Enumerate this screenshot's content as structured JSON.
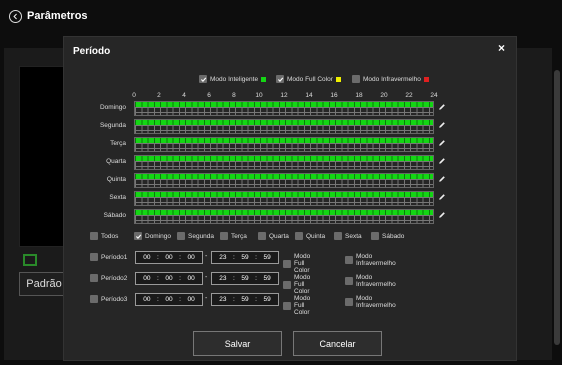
{
  "page": {
    "title": "Parâmetros"
  },
  "background": {
    "default_button": "Padrão"
  },
  "dialog": {
    "title": "Período",
    "close_label": "×",
    "legend": [
      {
        "label": "Modo Inteligente",
        "checked": true,
        "color": "#14d614"
      },
      {
        "label": "Modo Full Color",
        "checked": true,
        "color": "#f0f000"
      },
      {
        "label": "Modo Infravermelho",
        "checked": false,
        "color": "#e02020"
      }
    ],
    "hours": [
      "0",
      "2",
      "4",
      "6",
      "8",
      "10",
      "12",
      "14",
      "16",
      "18",
      "20",
      "22",
      "24"
    ],
    "days": [
      {
        "label": "Domingo",
        "coverage": 1.0
      },
      {
        "label": "Segunda",
        "coverage": 1.0
      },
      {
        "label": "Terça",
        "coverage": 1.0
      },
      {
        "label": "Quarta",
        "coverage": 1.0
      },
      {
        "label": "Quinta",
        "coverage": 1.0
      },
      {
        "label": "Sexta",
        "coverage": 1.0
      },
      {
        "label": "Sábado",
        "coverage": 1.0
      }
    ],
    "day_select": [
      {
        "label": "Todos",
        "checked": false
      },
      {
        "label": "Domingo",
        "checked": true
      },
      {
        "label": "Segunda",
        "checked": false
      },
      {
        "label": "Terça",
        "checked": false
      },
      {
        "label": "Quarta",
        "checked": false
      },
      {
        "label": "Quinta",
        "checked": false
      },
      {
        "label": "Sexta",
        "checked": false
      },
      {
        "label": "Sábado",
        "checked": false
      }
    ],
    "periods": [
      {
        "label": "Período1",
        "start": [
          "00",
          "00",
          "00"
        ],
        "end": [
          "23",
          "59",
          "59"
        ],
        "mode_a": "Modo Full Color",
        "mode_b": "Modo Infravermelho"
      },
      {
        "label": "Período2",
        "start": [
          "00",
          "00",
          "00"
        ],
        "end": [
          "23",
          "59",
          "59"
        ],
        "mode_a": "Modo Full Color",
        "mode_b": "Modo Infravermelho"
      },
      {
        "label": "Período3",
        "start": [
          "00",
          "00",
          "00"
        ],
        "end": [
          "23",
          "59",
          "59"
        ],
        "mode_a": "Modo Full Color",
        "mode_b": "Modo Infravermelho"
      }
    ],
    "time_separator": ":",
    "range_separator": "-",
    "save_label": "Salvar",
    "cancel_label": "Cancelar"
  }
}
